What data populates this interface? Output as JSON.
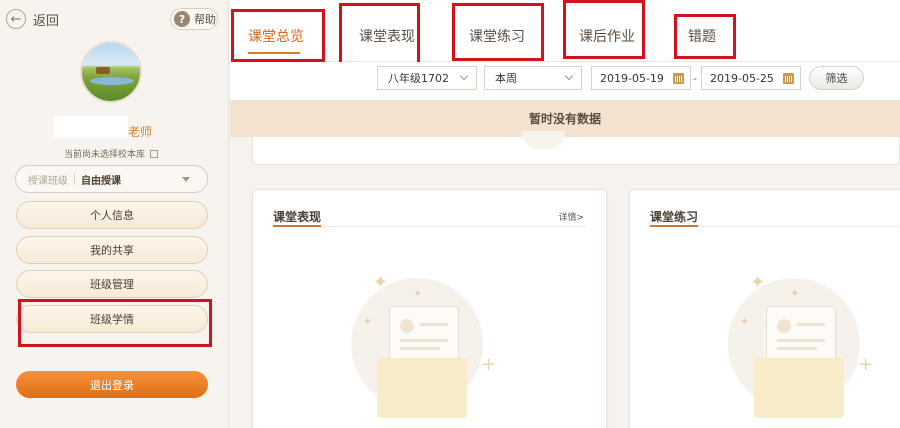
{
  "sidebar": {
    "back_label": "返回",
    "help_label": "帮助",
    "teacher_suffix": "老师",
    "school_hint": "当前尚未选择校本库",
    "class_select": {
      "label": "授课班级",
      "value": "自由授课"
    },
    "menu": [
      {
        "label": "个人信息"
      },
      {
        "label": "我的共享"
      },
      {
        "label": "班级管理"
      },
      {
        "label": "班级学情"
      }
    ],
    "logout_label": "退出登录"
  },
  "tabs": [
    {
      "label": "课堂总览",
      "active": true
    },
    {
      "label": "课堂表现",
      "active": false
    },
    {
      "label": "课堂练习",
      "active": false
    },
    {
      "label": "课后作业",
      "active": false
    },
    {
      "label": "错题",
      "active": false
    }
  ],
  "filters": {
    "grade_class": "八年级1702",
    "period": "本周",
    "date_from": "2019-05-19",
    "date_separator": "-",
    "date_to": "2019-05-25",
    "filter_button": "筛选"
  },
  "banner": {
    "message": "暂时没有数据"
  },
  "cards": [
    {
      "title": "课堂表现",
      "detail_link": "详情>"
    },
    {
      "title": "课堂练习"
    }
  ],
  "colors": {
    "accent": "#e07a2a",
    "highlight_border": "#d4121c",
    "banner_bg": "#f2e2cf"
  }
}
